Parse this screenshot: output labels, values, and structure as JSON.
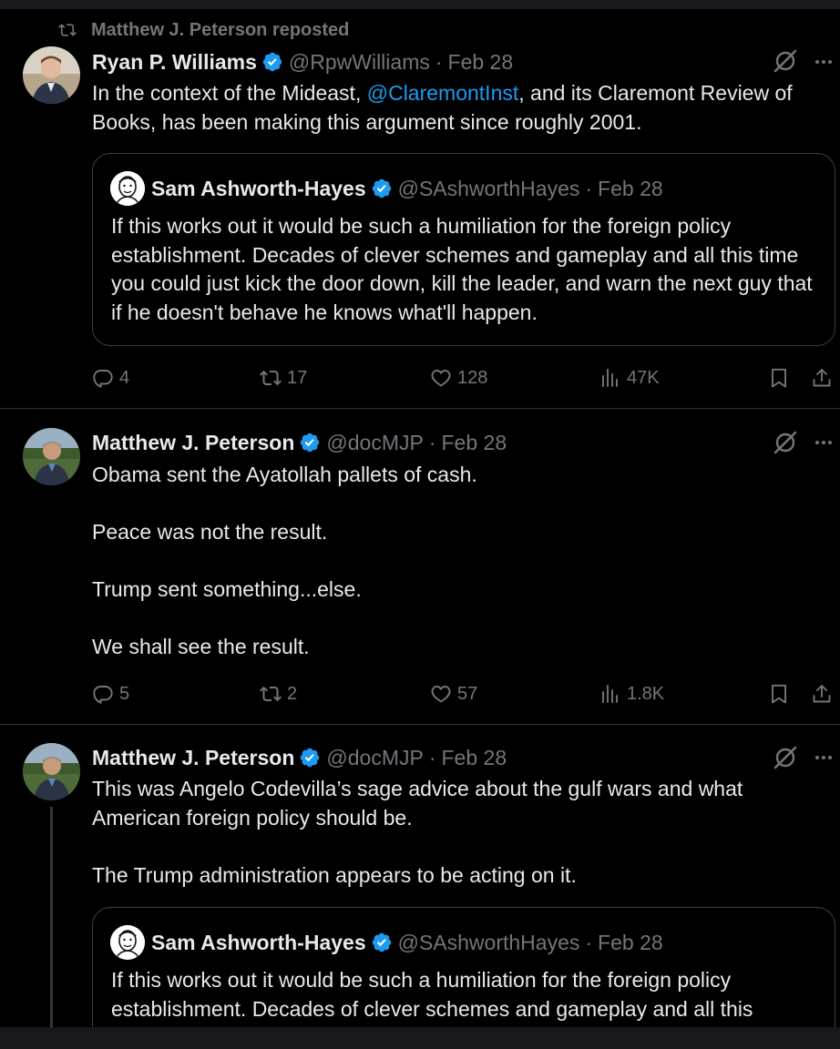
{
  "repost_label": "Matthew J. Peterson reposted",
  "colors": {
    "background": "#000000",
    "text": "#e7e9ea",
    "muted": "#71767b",
    "link": "#1d9bf0",
    "verified": "#1d9bf0",
    "border": "#2f3336"
  },
  "post1": {
    "name": "Ryan P. Williams",
    "handle": "@RpwWilliams",
    "separator": "·",
    "date": "Feb 28",
    "body_before": "In the context of the Mideast, ",
    "body_link": "@ClaremontInst",
    "body_after": ", and its Claremont Review of Books, has been making this argument since roughly 2001.",
    "quote": {
      "name": "Sam Ashworth-Hayes",
      "handle": "@SAshworthHayes",
      "separator": "·",
      "date": "Feb 28",
      "text": "If this works out it would be such a humiliation for the foreign policy establishment. Decades of clever schemes and gameplay and all this time you could just kick the door down, kill the leader, and warn the next guy that if he doesn't behave he knows what'll happen."
    },
    "replies": "4",
    "reposts": "17",
    "likes": "128",
    "views": "47K"
  },
  "post2": {
    "name": "Matthew J. Peterson",
    "handle": "@docMJP",
    "separator": "·",
    "date": "Feb 28",
    "para1": "Obama sent the Ayatollah pallets of cash.",
    "para2": "Peace was not the result.",
    "para3": "Trump sent something...else.",
    "para4": "We shall see the result.",
    "replies": "5",
    "reposts": "2",
    "likes": "57",
    "views": "1.8K"
  },
  "post3": {
    "name": "Matthew J. Peterson",
    "handle": "@docMJP",
    "separator": "·",
    "date": "Feb 28",
    "para1": "This was Angelo Codevilla’s sage advice about the gulf wars and what American foreign policy should be.",
    "para2": "The Trump administration appears to be acting on it.",
    "quote": {
      "name": "Sam Ashworth-Hayes",
      "handle": "@SAshworthHayes",
      "separator": "·",
      "date": "Feb 28",
      "text": "If this works out it would be such a humiliation for the foreign policy establishment. Decades of clever schemes and gameplay and all this"
    }
  },
  "icons": [
    "repost-icon",
    "verified-badge-icon",
    "grok-icon",
    "more-icon",
    "reply-icon",
    "like-icon",
    "views-icon",
    "bookmark-icon",
    "share-icon"
  ]
}
